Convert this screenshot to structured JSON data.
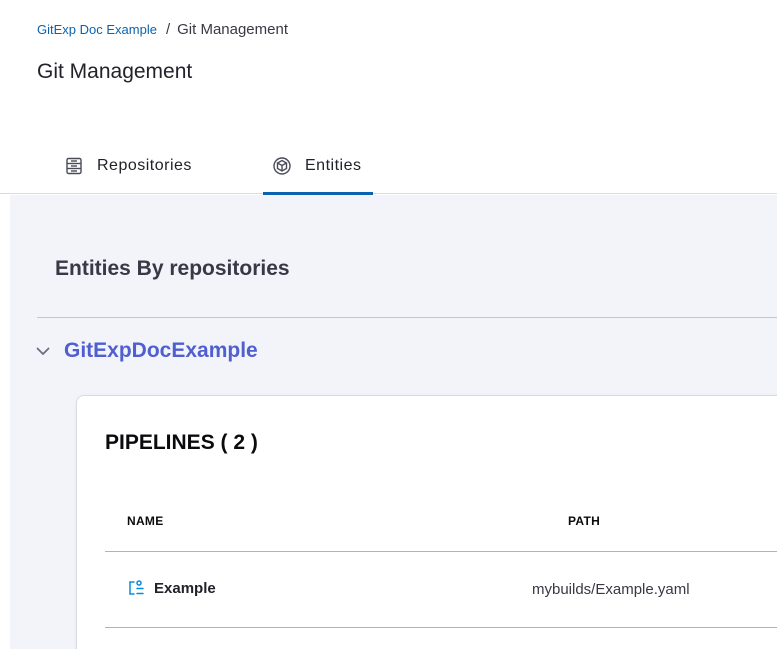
{
  "breadcrumb": {
    "link": "GitExp Doc Example",
    "separator": "/",
    "current": "Git Management"
  },
  "page": {
    "title": "Git Management"
  },
  "tabs": [
    {
      "label": "Repositories",
      "icon": "repository-icon",
      "active": false
    },
    {
      "label": "Entities",
      "icon": "entities-icon",
      "active": true
    }
  ],
  "main": {
    "section_title": "Entities By repositories",
    "repository": {
      "name": "GitExpDocExample",
      "expanded": true
    },
    "pipelines_card": {
      "title": "PIPELINES ( 2 )",
      "columns": [
        "NAME",
        "PATH"
      ],
      "rows": [
        {
          "name": "Example",
          "path": "mybuilds/Example.yaml",
          "icon": "pipeline-icon"
        }
      ]
    }
  },
  "colors": {
    "link": "#0b63b0",
    "accent": "#4f5fd0",
    "content_bg": "#f3f3fa"
  }
}
